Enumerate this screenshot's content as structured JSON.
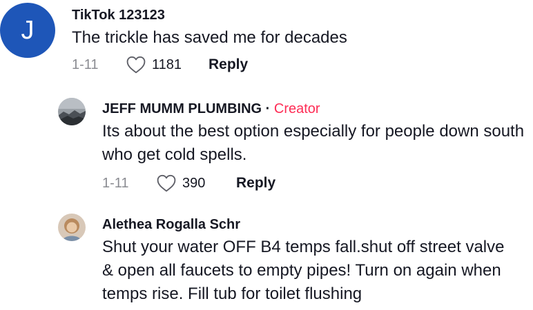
{
  "comments": [
    {
      "avatar_letter": "J",
      "username": "TikTok 123123",
      "text": "The trickle has saved me for decades",
      "date": "1-11",
      "likes": "1181",
      "reply_label": "Reply"
    }
  ],
  "replies": [
    {
      "username": "JEFF MUMM PLUMBING",
      "separator": "·",
      "badge": "Creator",
      "text": "Its about the best option especially for people down south who get cold spells.",
      "date": "1-11",
      "likes": "390",
      "reply_label": "Reply"
    },
    {
      "username": "Alethea Rogalla Schr",
      "text": "Shut your water OFF B4 temps fall.shut off street valve & open all faucets to empty pipes! Turn on again when temps rise. Fill tub for toilet flushing"
    }
  ],
  "colors": {
    "avatar_blue": "#1e56b8",
    "creator_pink": "#fe2c55",
    "muted_gray": "#8a8b91",
    "text_dark": "#161823"
  },
  "icons": {
    "like": "heart-outline-icon"
  }
}
